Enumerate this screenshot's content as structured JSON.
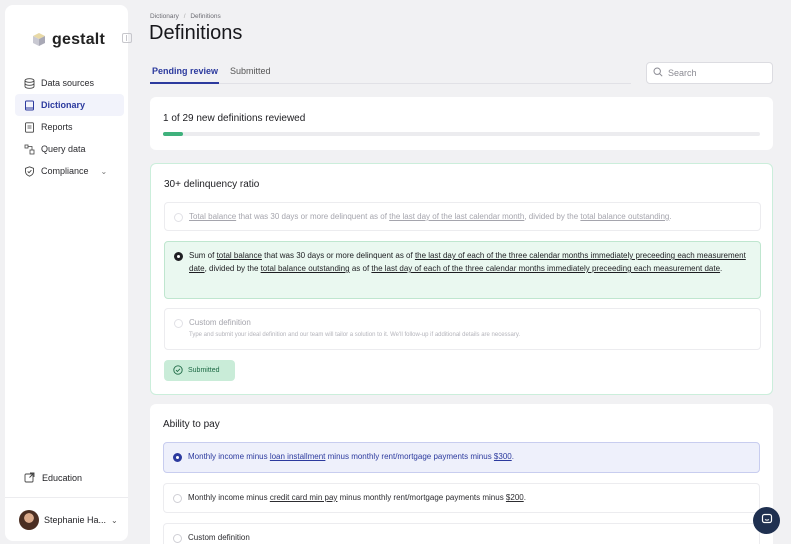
{
  "app": {
    "logo_text": "gestalt"
  },
  "sidebar": {
    "items": [
      {
        "label": "Data sources",
        "icon": "database-icon"
      },
      {
        "label": "Dictionary",
        "icon": "book-icon"
      },
      {
        "label": "Reports",
        "icon": "document-icon"
      },
      {
        "label": "Query data",
        "icon": "query-icon"
      },
      {
        "label": "Compliance",
        "icon": "shield-check-icon"
      }
    ],
    "education_label": "Education",
    "user_name": "Stephanie Ha..."
  },
  "header": {
    "breadcrumb": [
      "Dictionary",
      "Definitions"
    ],
    "title": "Definitions"
  },
  "tabs": [
    {
      "label": "Pending review"
    },
    {
      "label": "Submitted"
    }
  ],
  "search": {
    "placeholder": "Search"
  },
  "progress": {
    "text": "1 of 29 new definitions reviewed",
    "fraction": 0.034
  },
  "questions": [
    {
      "title": "30+ delinquency ratio",
      "options": [
        {
          "parts": [
            "",
            "Total balance",
            " that was 30 days or more delinquent as of ",
            "the last day of the last calendar month",
            ", divided by the ",
            "total balance outstanding",
            "."
          ]
        },
        {
          "parts": [
            "Sum of ",
            "total balance",
            " that was 30 days or more delinquent as of ",
            "the last day of each of the three calendar months immediately preceeding each measurement date",
            ", divided by the ",
            "total balance outstanding",
            " as of ",
            "the last day of each of the three calendar months immediately preceeding each measurement date",
            "."
          ]
        },
        {
          "title": "Custom definition",
          "subtitle": "Type and submit your ideal definition and our team will tailor a solution to it. We'll follow-up if additional details are necessary."
        }
      ],
      "badge": "Submitted"
    },
    {
      "title": "Ability to pay",
      "options": [
        {
          "parts": [
            "Monthly income minus ",
            "loan installment",
            " minus monthly rent/mortgage payments minus ",
            "$300",
            "."
          ]
        },
        {
          "parts": [
            "Monthly income minus ",
            "credit card min pay",
            " minus monthly rent/mortgage payments minus ",
            "$200",
            "."
          ]
        },
        {
          "title": "Custom definition"
        }
      ]
    }
  ],
  "colors": {
    "accent": "#2c3a9e",
    "success": "#3fb17c",
    "chat": "#1f3050"
  }
}
